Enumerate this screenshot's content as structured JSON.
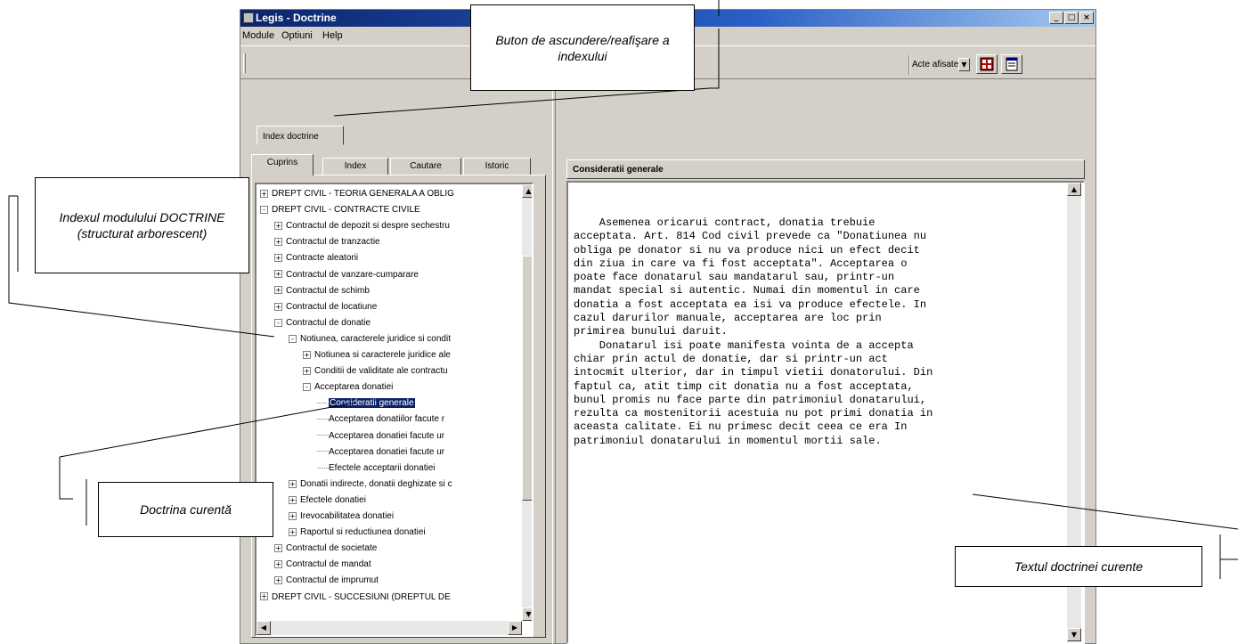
{
  "window": {
    "title": "Legis - Doctrine",
    "controls": [
      "_",
      "□",
      "×"
    ]
  },
  "menu": [
    "Module",
    "Optiuni",
    "Help"
  ],
  "toolbar": {
    "acts_label": "Acte afisate"
  },
  "index_header": "Index doctrine",
  "tabs": [
    "Cuprins",
    "Index",
    "Cautare",
    "Istoric"
  ],
  "tree": [
    {
      "label": "DREPT CIVIL - TEORIA GENERALA A OBLIG",
      "state": "+"
    },
    {
      "label": "DREPT CIVIL - CONTRACTE CIVILE",
      "state": "-"
    },
    {
      "label": "Contractul de depozit si despre sechestru",
      "state": "+"
    },
    {
      "label": "Contractul de tranzactie",
      "state": "+"
    },
    {
      "label": "Contracte aleatorii",
      "state": "+"
    },
    {
      "label": "Contractul de vanzare-cumparare",
      "state": "+"
    },
    {
      "label": "Contractul de schimb",
      "state": "+"
    },
    {
      "label": "Contractul de locatiune",
      "state": "+"
    },
    {
      "label": "Contractul de donatie",
      "state": "-"
    },
    {
      "label": "Notiunea, caracterele juridice si condit",
      "state": "-"
    },
    {
      "label": "Notiunea si caracterele juridice ale",
      "state": "+"
    },
    {
      "label": "Conditii de validitate ale contractu",
      "state": "+"
    },
    {
      "label": "Acceptarea donatiei",
      "state": "-"
    },
    {
      "label": "Consideratii generale",
      "state": "",
      "selected": true
    },
    {
      "label": "Acceptarea donatiilor facute r",
      "state": ""
    },
    {
      "label": "Acceptarea donatiei facute ur",
      "state": ""
    },
    {
      "label": "Acceptarea donatiei facute ur",
      "state": ""
    },
    {
      "label": "Efectele acceptarii donatiei",
      "state": ""
    },
    {
      "label": "Donatii indirecte, donatii deghizate si c",
      "state": "+"
    },
    {
      "label": "Efectele donatiei",
      "state": "+"
    },
    {
      "label": "Irevocabilitatea donatiei",
      "state": "+"
    },
    {
      "label": "Raportul si reductiunea donatiei",
      "state": "+"
    },
    {
      "label": "Contractul de societate",
      "state": "+"
    },
    {
      "label": "Contractul de mandat",
      "state": "+"
    },
    {
      "label": "Contractul de imprumut",
      "state": "+"
    },
    {
      "label": "DREPT CIVIL - SUCCESIUNI (DREPTUL DE",
      "state": "+"
    }
  ],
  "document": {
    "title": "Consideratii generale",
    "lines": [
      "    Asemenea oricarui contract, donatia trebuie",
      "acceptata. Art. 814 Cod civil prevede ca \"Donatiunea nu",
      "obliga pe donator si nu va produce nici un efect decit",
      "din ziua in care va fi fost acceptata\". Acceptarea o",
      "poate face donatarul sau mandatarul sau, printr-un",
      "mandat special si autentic. Numai din momentul in care",
      "donatia a fost acceptata ea isi va produce efectele. In",
      "cazul darurilor manuale, acceptarea are loc prin",
      "primirea bunului daruit.",
      "    Donatarul isi poate manifesta vointa de a accepta",
      "chiar prin actul de donatie, dar si printr-un act",
      "intocmit ulterior, dar in timpul vietii donatorului. Din",
      "faptul ca, atit timp cit donatia nu a fost acceptata,",
      "bunul promis nu face parte din patrimoniul donatarului,",
      "rezulta ca mostenitorii acestuia nu pot primi donatia in",
      "aceasta calitate. Ei nu primesc decit ceea ce era In",
      "patrimoniul donatarului in momentul mortii sale."
    ]
  },
  "callouts": {
    "toggle": "Buton de ascundere/reafişare a indexului",
    "index": "Indexul modulului DOCTRINE (structurat arborescent)",
    "current": "Doctrina curentă",
    "text": "Textul doctrinei curente"
  }
}
